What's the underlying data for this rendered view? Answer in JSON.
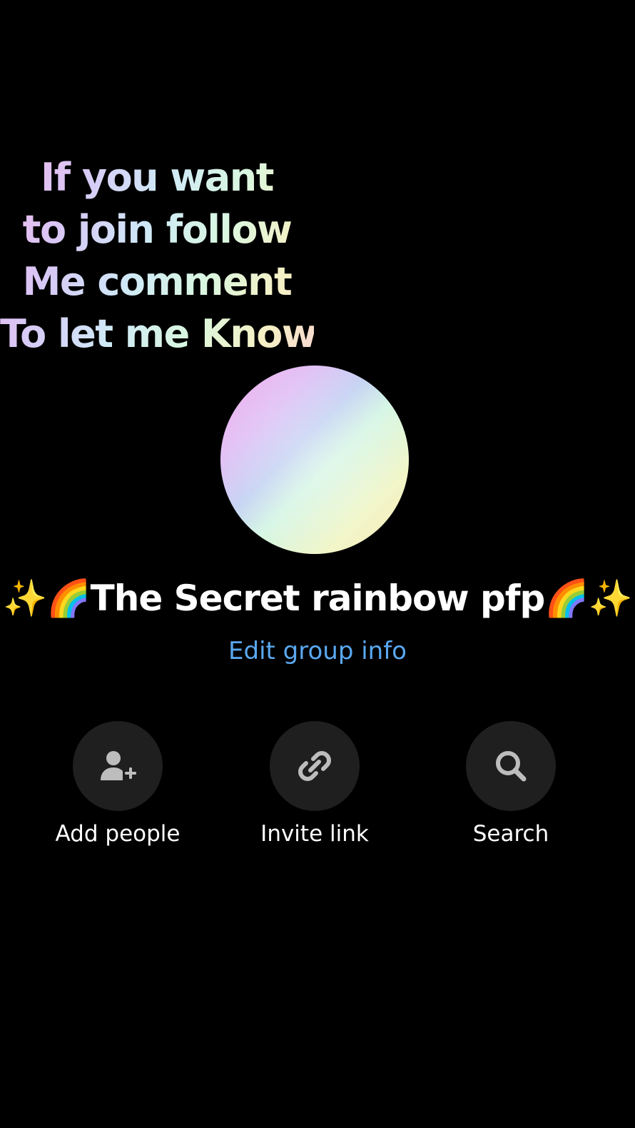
{
  "overlay": {
    "lines": [
      "If you want",
      "to join follow",
      "Me comment",
      "To let me Know"
    ]
  },
  "group": {
    "name": "✨🌈The Secret rainbow pfp🌈✨",
    "edit_label": "Edit group info"
  },
  "actions": [
    {
      "label": "Add people",
      "icon": "add-person-icon"
    },
    {
      "label": "Invite link",
      "icon": "link-icon"
    },
    {
      "label": "Search",
      "icon": "search-icon"
    }
  ],
  "colors": {
    "background": "#000000",
    "link": "#5aa8f0",
    "action_circle": "#1f1f1f",
    "icon": "#bdbdbd"
  }
}
